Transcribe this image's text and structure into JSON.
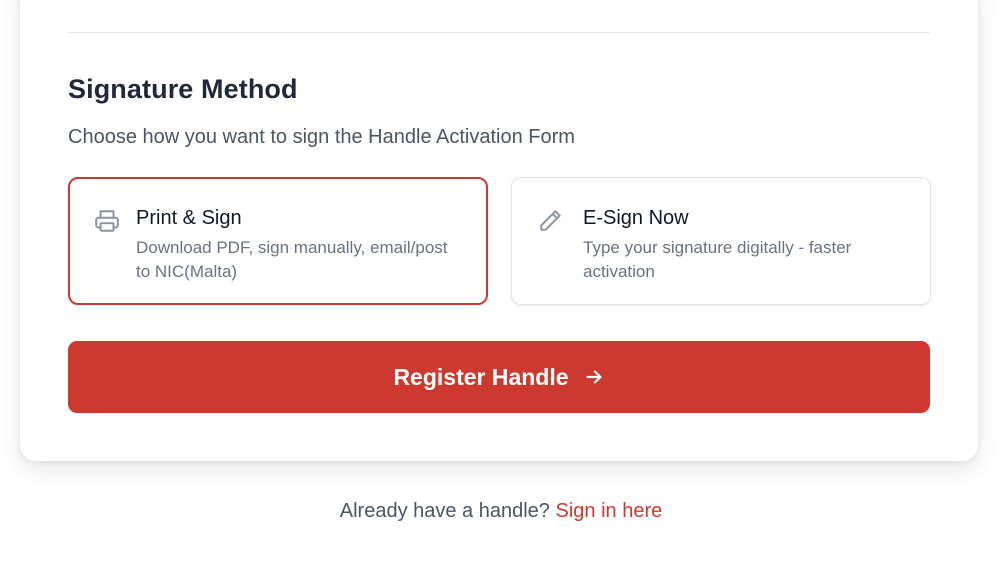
{
  "signature": {
    "title": "Signature Method",
    "subtitle": "Choose how you want to sign the Handle Activation Form",
    "options": [
      {
        "title": "Print & Sign",
        "description": "Download PDF, sign manually, email/post to NIC(Malta)",
        "icon": "printer-icon",
        "selected": true
      },
      {
        "title": "E-Sign Now",
        "description": "Type your signature digitally - faster activation",
        "icon": "pencil-icon",
        "selected": false
      }
    ]
  },
  "register": {
    "label": "Register Handle",
    "icon": "arrow-right-icon"
  },
  "footer": {
    "prompt": "Already have a handle?",
    "link": "Sign in here"
  },
  "colors": {
    "accent": "#cc3a2f",
    "heading": "#1f2937",
    "muted": "#6b7280",
    "border": "#e2e5ea"
  }
}
